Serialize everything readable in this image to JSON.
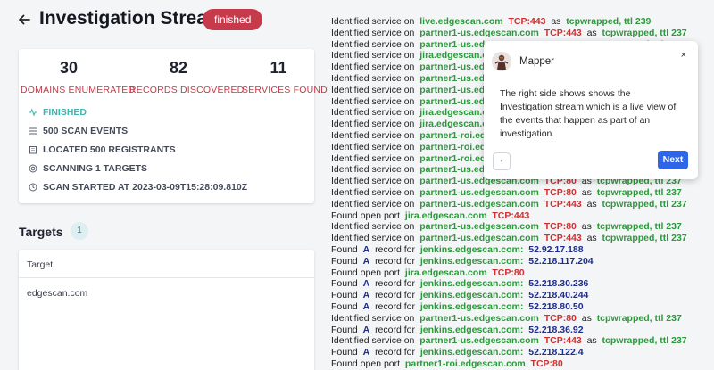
{
  "header": {
    "title": "Investigation Stream",
    "status_badge": "finished"
  },
  "stats": [
    {
      "value": "30",
      "label": "DOMAINS ENUMERATED"
    },
    {
      "value": "82",
      "label": "RECORDS DISCOVERED"
    },
    {
      "value": "11",
      "label": "SERVICES FOUND"
    }
  ],
  "info": {
    "status": "FINISHED",
    "events": "500 SCAN EVENTS",
    "registrants": "LOCATED 500 REGISTRANTS",
    "targets": "SCANNING 1 TARGETS",
    "started": "SCAN STARTED AT 2023-03-09T15:28:09.810Z"
  },
  "targets": {
    "title": "Targets",
    "count": "1",
    "column_header": "Target",
    "rows": [
      "edgescan.com"
    ]
  },
  "stream": [
    {
      "kind": "svc",
      "prefix": "Identified service on",
      "host": "live.edgescan.com",
      "port": "TCP:443",
      "as": "as",
      "service": "tcpwrapped, ttl 239"
    },
    {
      "kind": "svc",
      "prefix": "Identified service on",
      "host": "partner1-us.edgescan.com",
      "port": "TCP:443",
      "as": "as",
      "service": "tcpwrapped, ttl 237"
    },
    {
      "kind": "svc",
      "prefix": "Identified service on",
      "host": "partner1-us.edgescan.com",
      "port": "TCP:80",
      "as": "as",
      "service": "tcpwrapped, ttl 237"
    },
    {
      "kind": "svc",
      "prefix": "Identified service on",
      "host": "jira.edgescan.com",
      "port": "",
      "as": "",
      "service": ""
    },
    {
      "kind": "svc",
      "prefix": "Identified service on",
      "host": "partner1-us.edgescan.com",
      "port": "",
      "as": "",
      "service": ""
    },
    {
      "kind": "svc",
      "prefix": "Identified service on",
      "host": "partner1-us.edgescan.com",
      "port": "",
      "as": "",
      "service": ""
    },
    {
      "kind": "svc",
      "prefix": "Identified service on",
      "host": "partner1-us.edgescan.com",
      "port": "",
      "as": "",
      "service": ""
    },
    {
      "kind": "svc",
      "prefix": "Identified service on",
      "host": "partner1-us.edgescan.com",
      "port": "",
      "as": "",
      "service": ""
    },
    {
      "kind": "svc",
      "prefix": "Identified service on",
      "host": "jira.edgescan.com",
      "port": "",
      "as": "",
      "service": ""
    },
    {
      "kind": "svc",
      "prefix": "Identified service on",
      "host": "jira.edgescan.com",
      "port": "",
      "as": "",
      "service": ""
    },
    {
      "kind": "svc",
      "prefix": "Identified service on",
      "host": "partner1-roi.edgescan.com",
      "port": "",
      "as": "",
      "service": ""
    },
    {
      "kind": "svc",
      "prefix": "Identified service on",
      "host": "partner1-roi.edgescan.com",
      "port": "",
      "as": "",
      "service": ""
    },
    {
      "kind": "svc",
      "prefix": "Identified service on",
      "host": "partner1-roi.edgescan.com",
      "port": "",
      "as": "",
      "service": ""
    },
    {
      "kind": "svc",
      "prefix": "Identified service on",
      "host": "partner1-us.edgescan.com",
      "port": "",
      "as": "",
      "service": ""
    },
    {
      "kind": "svc",
      "prefix": "Identified service on",
      "host": "partner1-us.edgescan.com",
      "port": "TCP:80",
      "as": "as",
      "service": "tcpwrapped, ttl 237"
    },
    {
      "kind": "svc",
      "prefix": "Identified service on",
      "host": "partner1-us.edgescan.com",
      "port": "TCP:80",
      "as": "as",
      "service": "tcpwrapped, ttl 237"
    },
    {
      "kind": "svc",
      "prefix": "Identified service on",
      "host": "partner1-us.edgescan.com",
      "port": "TCP:443",
      "as": "as",
      "service": "tcpwrapped, ttl 237"
    },
    {
      "kind": "open",
      "prefix": "Found open port",
      "host": "jira.edgescan.com",
      "port": "TCP:443"
    },
    {
      "kind": "svc",
      "prefix": "Identified service on",
      "host": "partner1-us.edgescan.com",
      "port": "TCP:80",
      "as": "as",
      "service": "tcpwrapped, ttl 237"
    },
    {
      "kind": "svc",
      "prefix": "Identified service on",
      "host": "partner1-us.edgescan.com",
      "port": "TCP:443",
      "as": "as",
      "service": "tcpwrapped, ttl 237"
    },
    {
      "kind": "rec",
      "prefix": "Found",
      "rtype": "A",
      "mid": "record for",
      "host": "jenkins.edgescan.com:",
      "ip": "52.92.17.188"
    },
    {
      "kind": "rec",
      "prefix": "Found",
      "rtype": "A",
      "mid": "record for",
      "host": "jenkins.edgescan.com:",
      "ip": "52.218.117.204"
    },
    {
      "kind": "open",
      "prefix": "Found open port",
      "host": "jira.edgescan.com",
      "port": "TCP:80"
    },
    {
      "kind": "rec",
      "prefix": "Found",
      "rtype": "A",
      "mid": "record for",
      "host": "jenkins.edgescan.com:",
      "ip": "52.218.30.236"
    },
    {
      "kind": "rec",
      "prefix": "Found",
      "rtype": "A",
      "mid": "record for",
      "host": "jenkins.edgescan.com:",
      "ip": "52.218.40.244"
    },
    {
      "kind": "rec",
      "prefix": "Found",
      "rtype": "A",
      "mid": "record for",
      "host": "jenkins.edgescan.com:",
      "ip": "52.218.80.50"
    },
    {
      "kind": "svc",
      "prefix": "Identified service on",
      "host": "partner1-us.edgescan.com",
      "port": "TCP:80",
      "as": "as",
      "service": "tcpwrapped, ttl 237"
    },
    {
      "kind": "rec",
      "prefix": "Found",
      "rtype": "A",
      "mid": "record for",
      "host": "jenkins.edgescan.com:",
      "ip": "52.218.36.92"
    },
    {
      "kind": "svc",
      "prefix": "Identified service on",
      "host": "partner1-us.edgescan.com",
      "port": "TCP:443",
      "as": "as",
      "service": "tcpwrapped, ttl 237"
    },
    {
      "kind": "rec",
      "prefix": "Found",
      "rtype": "A",
      "mid": "record for",
      "host": "jenkins.edgescan.com:",
      "ip": "52.218.122.4"
    },
    {
      "kind": "open",
      "prefix": "Found open port",
      "host": "partner1-roi.edgescan.com",
      "port": "TCP:80"
    }
  ],
  "tooltip": {
    "name": "Mapper",
    "close": "×",
    "body": "The right side shows shows the Investigation stream which is a live view of the events that happen as part of an investigation.",
    "prev": "‹",
    "next": "Next"
  },
  "colors": {
    "accent": "#c73a4c",
    "finished": "#3eb6b0",
    "next_button": "#2f66e8",
    "host": "#2b9a3a",
    "port": "#d0302f",
    "ip": "#1d2e8c"
  }
}
